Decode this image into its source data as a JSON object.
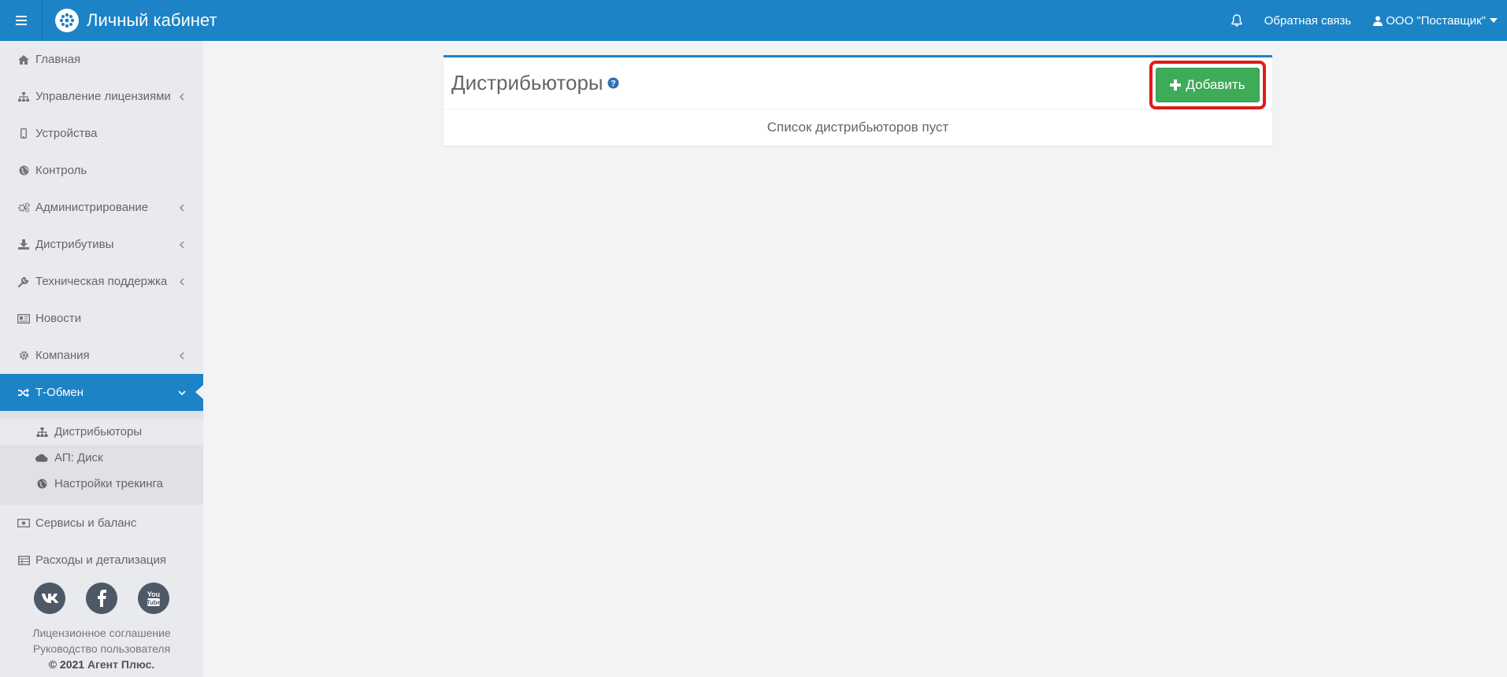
{
  "header": {
    "title": "Личный кабинет",
    "feedback": "Обратная связь",
    "user": "ООО \"Поставщик\""
  },
  "sidebar": {
    "items": [
      {
        "label": "Главная",
        "icon": "home-icon"
      },
      {
        "label": "Управление лицензиями",
        "icon": "sitemap-icon"
      },
      {
        "label": "Устройства",
        "icon": "mobile-icon"
      },
      {
        "label": "Контроль",
        "icon": "globe-icon"
      },
      {
        "label": "Администрирование",
        "icon": "gears-icon"
      },
      {
        "label": "Дистрибутивы",
        "icon": "download-icon"
      },
      {
        "label": "Техническая поддержка",
        "icon": "wrench-icon"
      },
      {
        "label": "Новости",
        "icon": "newspaper-icon"
      },
      {
        "label": "Компания",
        "icon": "gear-icon"
      },
      {
        "label": "Т-Обмен",
        "icon": "shuffle-icon"
      }
    ],
    "submenu": [
      {
        "label": "Дистрибьюторы",
        "icon": "sitemap-icon"
      },
      {
        "label": "АП: Диск",
        "icon": "cloud-icon"
      },
      {
        "label": "Настройки трекинга",
        "icon": "globe-icon"
      }
    ],
    "items_after": [
      {
        "label": "Сервисы и баланс",
        "icon": "money-icon"
      },
      {
        "label": "Расходы и детализация",
        "icon": "table-icon"
      }
    ],
    "footer": {
      "license": "Лицензионное соглашение",
      "guide": "Руководство пользователя",
      "copyright": "© 2021",
      "company": "Агент Плюс."
    }
  },
  "main": {
    "title": "Дистрибьюторы",
    "add_button": "Добавить",
    "empty_message": "Список дистрибьюторов пуст"
  },
  "colors": {
    "header": "#1c83c6",
    "accent_green": "#3dab58",
    "highlight_red": "#e11b1b"
  }
}
